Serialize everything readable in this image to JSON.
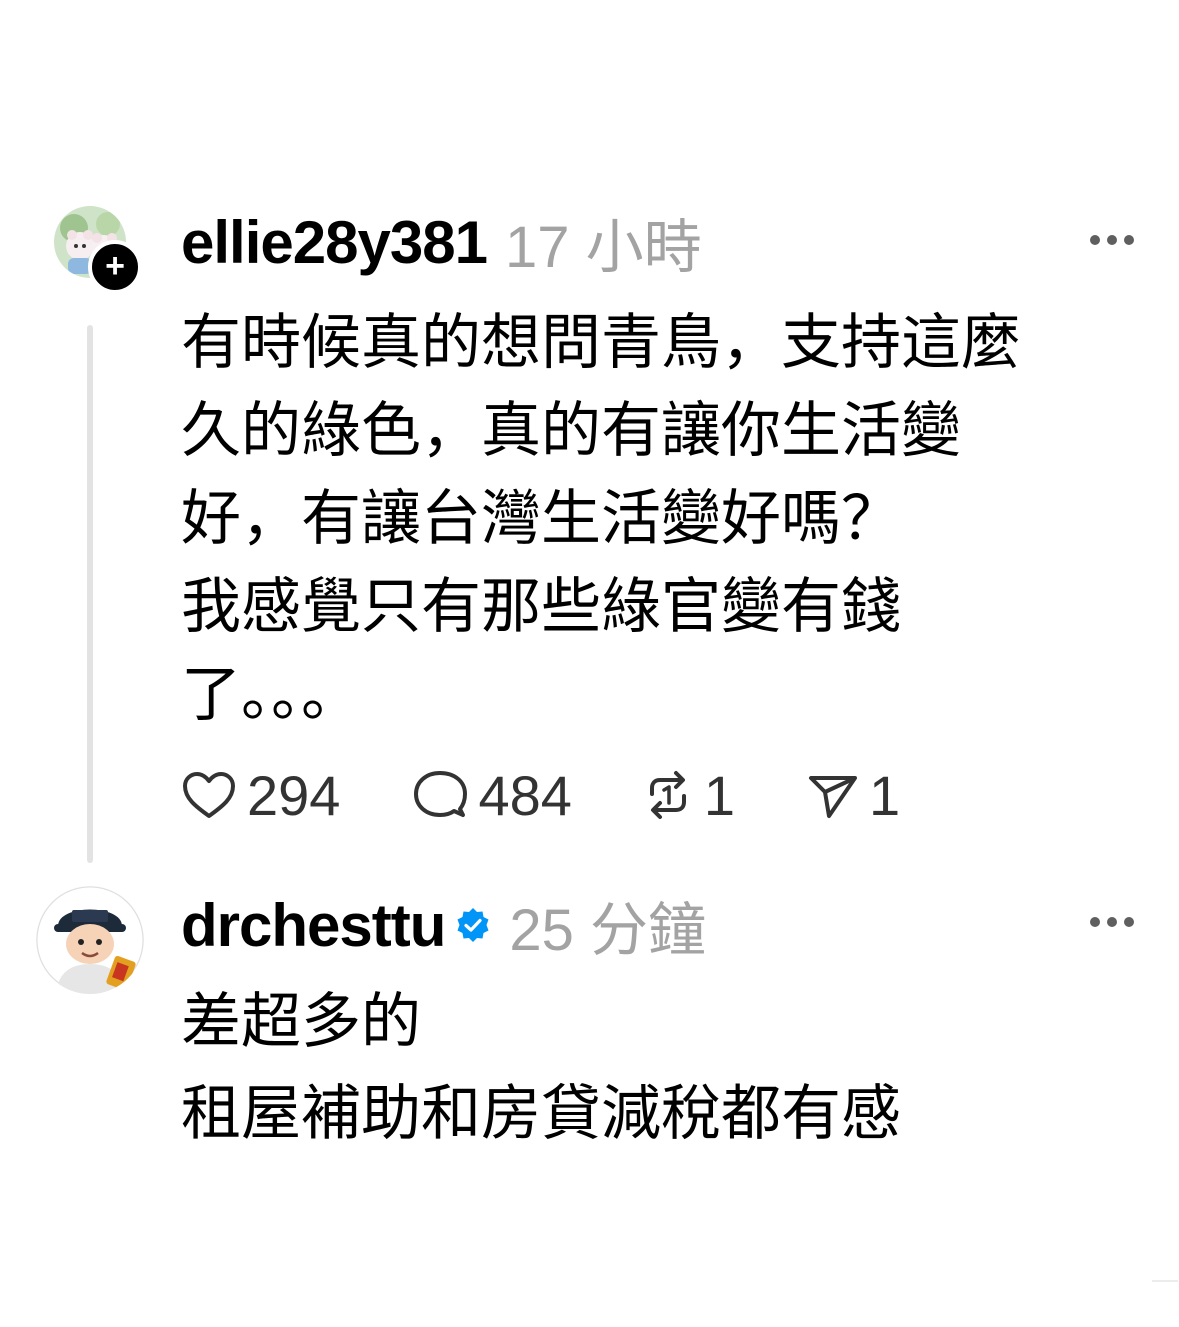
{
  "posts": [
    {
      "username": "ellie28y381",
      "timestamp": "17 小時",
      "verified": false,
      "follow_badge": "+",
      "avatar_icon": "avatar-two-plush-bears",
      "body_lines": [
        "有時候真的想問青鳥，支持這麼",
        "久的綠色，真的有讓你生活變",
        "好，有讓台灣生活變好嗎？",
        "我感覺只有那些綠官變有錢",
        "了。。。"
      ],
      "actions": {
        "likes": "294",
        "replies": "484",
        "reposts": "1",
        "shares": "1"
      }
    },
    {
      "username": "drchesttu",
      "timestamp": "25 分鐘",
      "verified": true,
      "avatar_icon": "avatar-cartoon-man-cap",
      "body_lines": [
        "差超多的",
        "租屋補助和房貸減稅都有感"
      ]
    }
  ],
  "colors": {
    "text": "#000000",
    "muted": "#a3a3a3",
    "verified": "#0095f6",
    "thread_line": "#e3e3e3"
  }
}
